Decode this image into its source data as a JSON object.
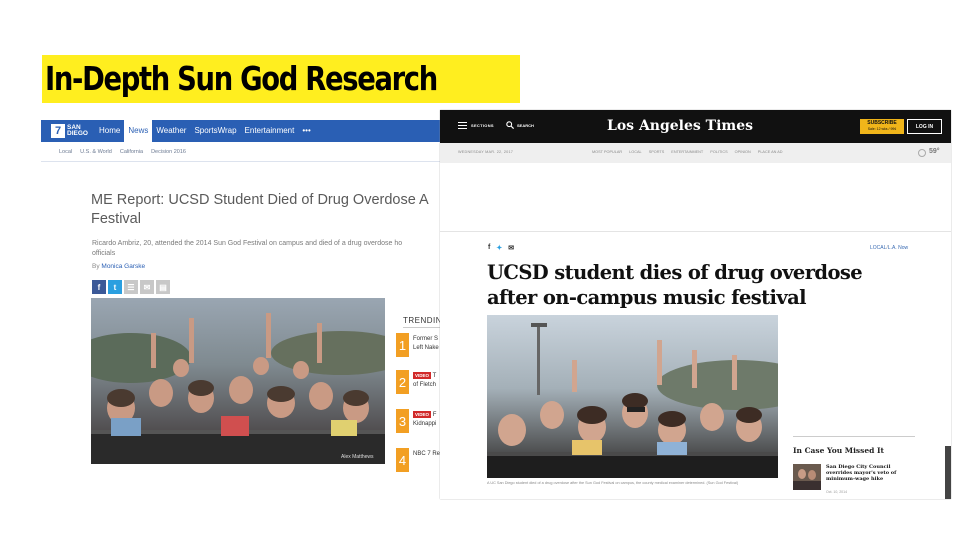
{
  "slide": {
    "title": "In-Depth Sun God Research"
  },
  "nbc": {
    "logo_mark": "7",
    "logo_text_line1": "SAN",
    "logo_text_line2": "DIEGO",
    "nav": [
      "Home",
      "News",
      "Weather",
      "SportsWrap",
      "Entertainment",
      "•••"
    ],
    "active_nav": "News",
    "subnav": [
      "Local",
      "U.S. & World",
      "California",
      "Decision 2016"
    ],
    "headline_line1": "ME Report: UCSD Student Died of Drug Overdose A",
    "headline_line2": "Festival",
    "summary_line1": "Ricardo Ambriz, 20, attended the 2014 Sun God Festival on campus and died of a drug overdose ho",
    "summary_line2": "officials",
    "byline_prefix": "By",
    "author": "Monica Garske",
    "share": [
      {
        "icon": "facebook-icon",
        "glyph": "f",
        "color": "#3b5998"
      },
      {
        "icon": "twitter-icon",
        "glyph": "t",
        "color": "#2a9fe0"
      },
      {
        "icon": "comment-icon",
        "glyph": "☰",
        "color": "#c8c8c8"
      },
      {
        "icon": "email-icon",
        "glyph": "✉",
        "color": "#c8c8c8"
      },
      {
        "icon": "print-icon",
        "glyph": "▤",
        "color": "#c8c8c8"
      }
    ],
    "photo_credit": "Alex Matthews",
    "trending_label": "TRENDING",
    "trending": [
      {
        "num": "1",
        "badge": "",
        "line1": "Former S",
        "line2": "Left Nake"
      },
      {
        "num": "2",
        "badge": "VIDEO",
        "line1": "T",
        "line2": "of Fletch"
      },
      {
        "num": "3",
        "badge": "VIDEO",
        "line1": "F",
        "line2": "Kidnappi"
      },
      {
        "num": "4",
        "badge": "",
        "line1": "NBC 7 Re",
        "line2": ""
      }
    ],
    "colors": {
      "brand": "#2a5fb4",
      "trending": "#f29f23"
    }
  },
  "lat": {
    "sections_label": "SECTIONS",
    "search_label": "SEARCH",
    "logo": "Los Angeles Times",
    "subscribe_label": "SUBSCRIBE",
    "subscribe_sub": "Sale: 12 wks / 99¢",
    "login_label": "LOG IN",
    "date": "WEDNESDAY MAR. 22, 2017",
    "sections": [
      "MOST POPULAR",
      "LOCAL",
      "SPORTS",
      "ENTERTAINMENT",
      "POLITICS",
      "OPINION",
      "PLACE AN AD"
    ],
    "temperature": "59°",
    "section_tag": "LOCAL",
    "section_tag_sub": "L.A. Now",
    "headline": "UCSD student dies of drug overdose after on-campus music festival",
    "caption": "A UC San Diego student died of a drug overdose after the Sun God Festival on campus, the county medical examiner determined. (Sun God Festival)",
    "icymi_title": "In Case You Missed It",
    "icymi_headline": "San Diego City Council overrides mayor's veto of minimum-wage hike",
    "icymi_date": "Oct. 10, 2014",
    "colors": {
      "header": "#111111",
      "subscribe": "#f0b51a"
    }
  }
}
